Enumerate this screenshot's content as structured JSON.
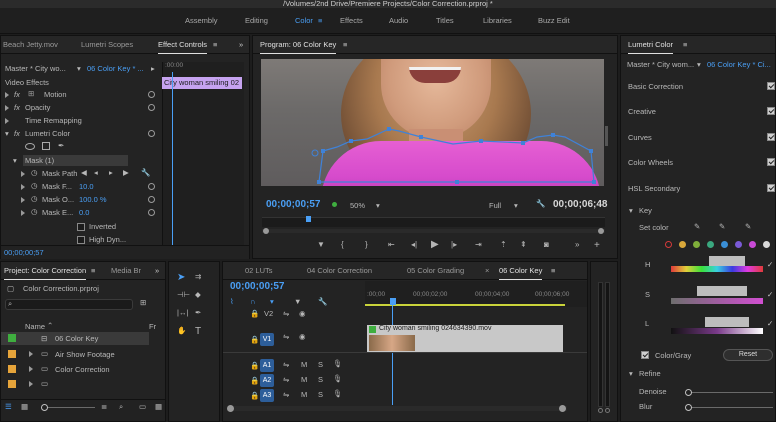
{
  "window": {
    "title": "/Volumes/2nd Drive/Premiere Projects/Color Correction.prproj *"
  },
  "workspaces": {
    "items": [
      "Assembly",
      "Editing",
      "Color",
      "Effects",
      "Audio",
      "Titles",
      "Libraries",
      "Buzz Edit"
    ],
    "active": "Color",
    "menu_icon": "hamburger-icon"
  },
  "source_panel": {
    "tabs": [
      "Beach Jetty.mov",
      "Lumetri Scopes",
      "Effect Controls"
    ],
    "active_tab": "Effect Controls",
    "master_label": "Master * City wo...",
    "sequence_label": "06 Color Key * ...",
    "ruler_time": ":00:00",
    "clip_label": "City woman smiling 02",
    "section": "Video Effects",
    "effects": [
      "Motion",
      "Opacity",
      "Time Remapping",
      "Lumetri Color"
    ],
    "mask_label": "Mask (1)",
    "mask_path_label": "Mask Path",
    "mask_feather_label": "Mask F...",
    "mask_feather_value": "10.0",
    "mask_opacity_label": "Mask O...",
    "mask_opacity_value": "100.0 %",
    "mask_expansion_label": "Mask E...",
    "mask_expansion_value": "0.0",
    "inverted_label": "Inverted",
    "high_dynamic_label": "High Dyn...",
    "timecode": "00;00;00;57"
  },
  "program": {
    "title": "Program: 06 Color Key",
    "timecode": "00;00;00;57",
    "zoom": "50%",
    "quality": "Full",
    "duration": "00;00;06;48"
  },
  "project": {
    "tabs": [
      "Project: Color Correction",
      "Media Br"
    ],
    "file": "Color Correction.prproj",
    "column_name": "Name",
    "column_fr": "Fr",
    "items": [
      {
        "name": "06 Color Key",
        "color": "#3fae3f"
      },
      {
        "name": "Air Show Footage",
        "color": "#e6a43a"
      },
      {
        "name": "Color Correction",
        "color": "#e6a43a"
      },
      {
        "name": "",
        "color": "#e6a43a"
      }
    ]
  },
  "timeline": {
    "tabs": [
      "02 LUTs",
      "04 Color Correction",
      "05 Color Grading",
      "06 Color Key"
    ],
    "active_tab": "06 Color Key",
    "timecode": "00;00;00;57",
    "ruler": [
      ":00;00",
      "00;00;02;00",
      "00;00;04;00",
      "00;00;06;00"
    ],
    "tracks_video": [
      "V2",
      "V1"
    ],
    "tracks_audio": [
      "A1",
      "A2",
      "A3"
    ],
    "clip_label": "City woman smiling 024634390.mov",
    "track_m": "M",
    "track_s": "S"
  },
  "lumetri": {
    "title": "Lumetri Color",
    "master_label": "Master * City wom...",
    "sequence_label": "06 Color Key * Ci...",
    "sections": [
      "Basic Correction",
      "Creative",
      "Curves",
      "Color Wheels",
      "HSL Secondary"
    ],
    "key_label": "Key",
    "set_color_label": "Set color",
    "h_label": "H",
    "s_label": "S",
    "l_label": "L",
    "color_gray_label": "Color/Gray",
    "reset_label": "Reset",
    "refine_label": "Refine",
    "denoise_label": "Denoise",
    "blur_label": "Blur",
    "swatches": [
      "#d63a3a",
      "#d9a83a",
      "#7fae3a",
      "#3aa87f",
      "#3a8fd6",
      "#7a5ad6",
      "#c94ad6",
      "#d9d9d9"
    ]
  },
  "colors": {
    "accent": "#4a9ff5",
    "track_blue": "#2d5e9a",
    "playhead": "#4a9ff5",
    "clip_label_bg": "#c6a3f0"
  }
}
